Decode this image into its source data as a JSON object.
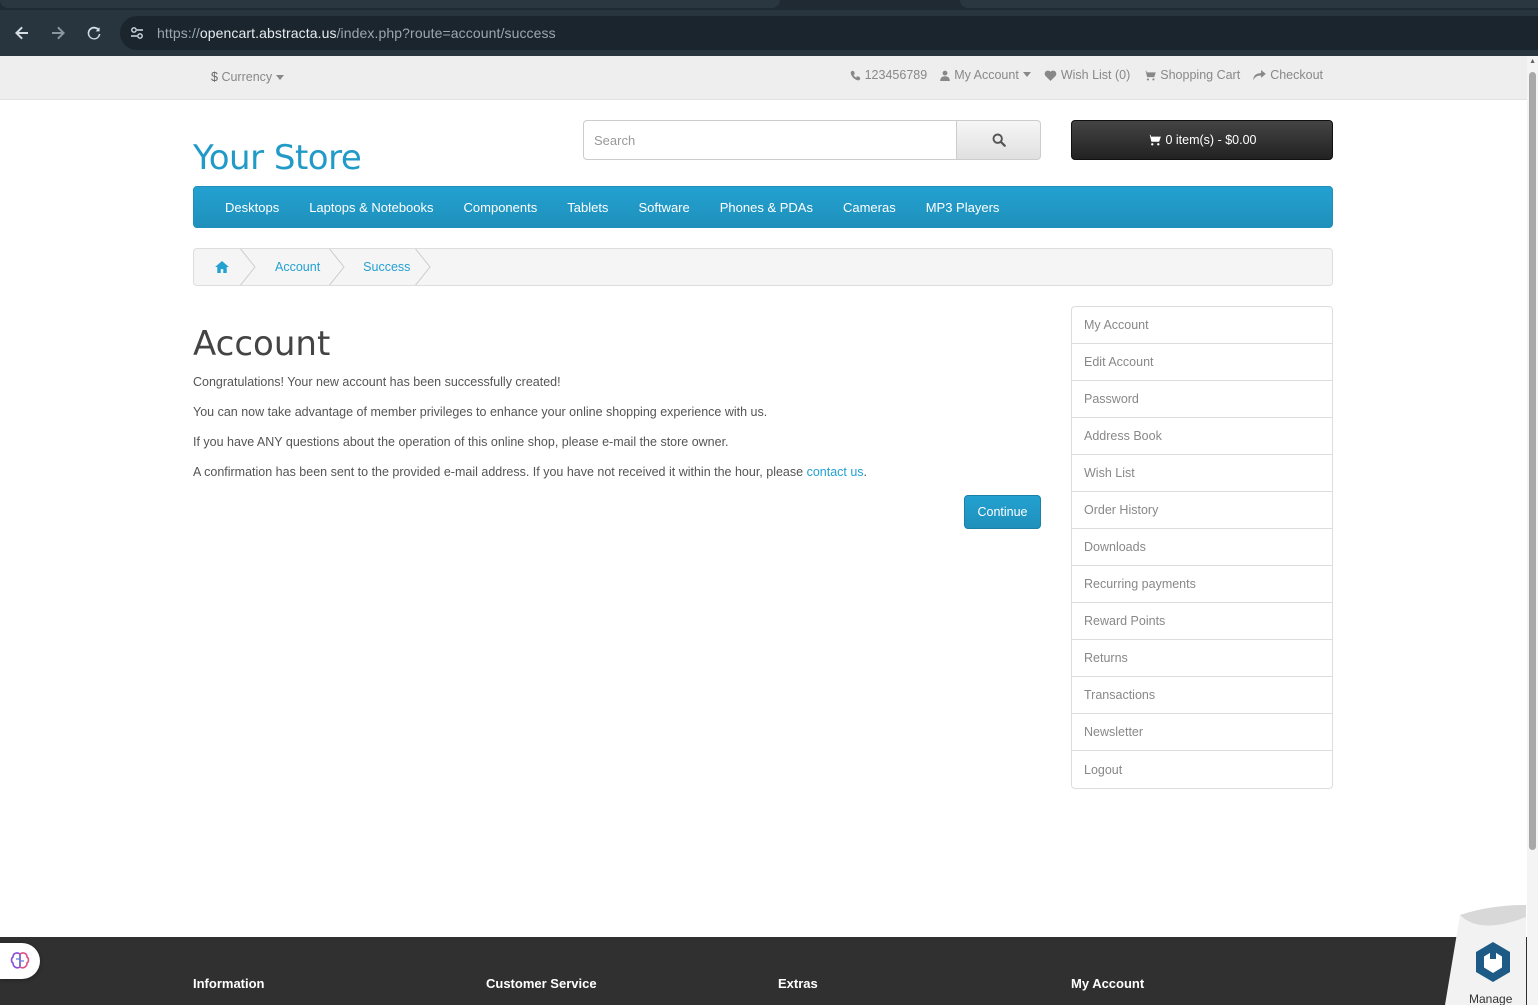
{
  "browser": {
    "url_prefix": "https://",
    "url_host": "opencart.abstracta.us",
    "url_path": "/index.php?route=account/success"
  },
  "topbar": {
    "currency_label": "Currency",
    "currency_symbol": "$",
    "phone": "123456789",
    "my_account": "My Account",
    "wish_list": "Wish List (0)",
    "shopping_cart": "Shopping Cart",
    "checkout": "Checkout"
  },
  "header": {
    "logo": "Your Store",
    "search_placeholder": "Search",
    "cart_button": "0 item(s) - $0.00"
  },
  "menu": {
    "items": [
      "Desktops",
      "Laptops & Notebooks",
      "Components",
      "Tablets",
      "Software",
      "Phones & PDAs",
      "Cameras",
      "MP3 Players"
    ]
  },
  "breadcrumb": {
    "items": [
      "Account",
      "Success"
    ]
  },
  "content": {
    "title": "Account",
    "p1": "Congratulations! Your new account has been successfully created!",
    "p2": "You can now take advantage of member privileges to enhance your online shopping experience with us.",
    "p3": "If you have ANY questions about the operation of this online shop, please e-mail the store owner.",
    "p4_text": "A confirmation has been sent to the provided e-mail address. If you have not received it within the hour, please ",
    "p4_link": "contact us",
    "p4_end": ".",
    "continue": "Continue"
  },
  "sidebar": {
    "items": [
      "My Account",
      "Edit Account",
      "Password",
      "Address Book",
      "Wish List",
      "Order History",
      "Downloads",
      "Recurring payments",
      "Reward Points",
      "Returns",
      "Transactions",
      "Newsletter",
      "Logout"
    ]
  },
  "footer": {
    "headings": [
      "Information",
      "Customer Service",
      "Extras",
      "My Account"
    ]
  },
  "widgets": {
    "manage_label": "Manage"
  },
  "colors": {
    "accent": "#229ac8",
    "footer_bg": "#303030",
    "browser_bg": "#28343e"
  }
}
